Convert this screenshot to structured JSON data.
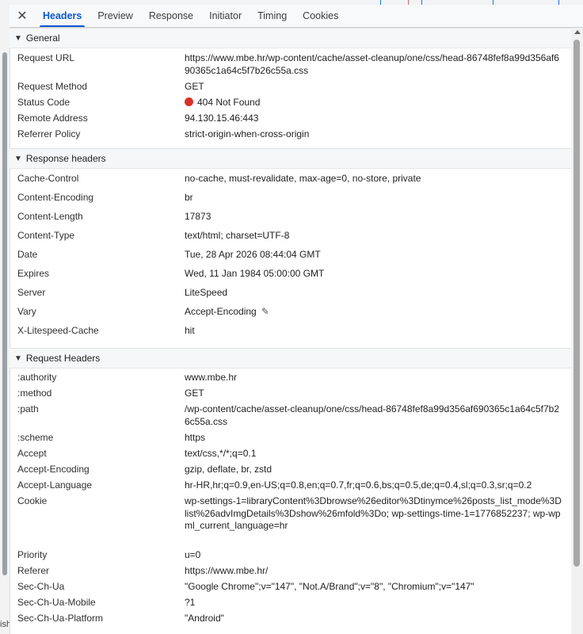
{
  "tabs": {
    "close_icon": "close-icon",
    "items": [
      {
        "label": "Headers",
        "active": true
      },
      {
        "label": "Preview"
      },
      {
        "label": "Response"
      },
      {
        "label": "Initiator"
      },
      {
        "label": "Timing"
      },
      {
        "label": "Cookies"
      }
    ]
  },
  "colors": {
    "accent": "#0b57d0",
    "status_error": "#d93025"
  },
  "sidebar_snip": "ish",
  "general": {
    "title": "General",
    "rows": [
      {
        "key": "Request URL",
        "value": "https://www.mbe.hr/wp-content/cache/asset-cleanup/one/css/head-86748fef8a99d356af690365c1a64c5f7b26c55a.css"
      },
      {
        "key": "Request Method",
        "value": "GET"
      },
      {
        "key": "Status Code",
        "value": "404 Not Found"
      },
      {
        "key": "Remote Address",
        "value": "94.130.15.46:443"
      },
      {
        "key": "Referrer Policy",
        "value": "strict-origin-when-cross-origin"
      }
    ]
  },
  "response_headers": {
    "title": "Response headers",
    "rows": [
      {
        "key": "Cache-Control",
        "value": "no-cache, must-revalidate, max-age=0, no-store, private"
      },
      {
        "key": "Content-Encoding",
        "value": "br"
      },
      {
        "key": "Content-Length",
        "value": "17873"
      },
      {
        "key": "Content-Type",
        "value": "text/html; charset=UTF-8"
      },
      {
        "key": "Date",
        "value": "Tue, 28 Apr 2026 08:44:04 GMT"
      },
      {
        "key": "Expires",
        "value": "Wed, 11 Jan 1984 05:00:00 GMT"
      },
      {
        "key": "Server",
        "value": "LiteSpeed"
      },
      {
        "key": "Vary",
        "value": "Accept-Encoding"
      },
      {
        "key": "X-Litespeed-Cache",
        "value": "hit"
      }
    ]
  },
  "request_headers": {
    "title": "Request Headers",
    "rows": [
      {
        "key": ":authority",
        "value": "www.mbe.hr"
      },
      {
        "key": ":method",
        "value": "GET"
      },
      {
        "key": ":path",
        "value": "/wp-content/cache/asset-cleanup/one/css/head-86748fef8a99d356af690365c1a64c5f7b26c55a.css"
      },
      {
        "key": ":scheme",
        "value": "https"
      },
      {
        "key": "Accept",
        "value": "text/css,*/*;q=0.1"
      },
      {
        "key": "Accept-Encoding",
        "value": "gzip, deflate, br, zstd"
      },
      {
        "key": "Accept-Language",
        "value": "hr-HR,hr;q=0.9,en-US;q=0.8,en;q=0.7,fr;q=0.6,bs;q=0.5,de;q=0.4,sl;q=0.3,sr;q=0.2"
      },
      {
        "key": "Cookie",
        "value": "wp-settings-1=libraryContent%3Dbrowse%26editor%3Dtinymce%26posts_list_mode%3Dlist%26advImgDetails%3Dshow%26mfold%3Do; wp-settings-time-1=1776852237; wp-wpml_current_language=hr"
      },
      {
        "key": "Priority",
        "value": "u=0"
      },
      {
        "key": "Referer",
        "value": "https://www.mbe.hr/"
      },
      {
        "key": "Sec-Ch-Ua",
        "value": "\"Google Chrome\";v=\"147\", \"Not.A/Brand\";v=\"8\", \"Chromium\";v=\"147\""
      },
      {
        "key": "Sec-Ch-Ua-Mobile",
        "value": "?1"
      },
      {
        "key": "Sec-Ch-Ua-Platform",
        "value": "\"Android\""
      }
    ]
  }
}
